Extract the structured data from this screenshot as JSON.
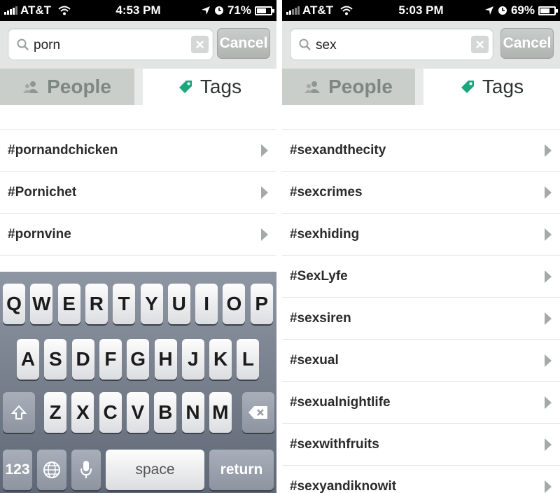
{
  "left": {
    "status": {
      "carrier": "AT&T",
      "time": "4:53 PM",
      "battery": "71%",
      "battery_level": 0.71
    },
    "search": {
      "query": "porn",
      "cancel_label": "Cancel"
    },
    "tabs": {
      "people_label": "People",
      "tags_label": "Tags",
      "active": "Tags"
    },
    "results": [
      "#pornandchicken",
      "#Pornichet",
      "#pornvine"
    ],
    "keyboard": {
      "row1": [
        "Q",
        "W",
        "E",
        "R",
        "T",
        "Y",
        "U",
        "I",
        "O",
        "P"
      ],
      "row2": [
        "A",
        "S",
        "D",
        "F",
        "G",
        "H",
        "J",
        "K",
        "L"
      ],
      "row3": [
        "Z",
        "X",
        "C",
        "V",
        "B",
        "N",
        "M"
      ],
      "numbers_label": "123",
      "space_label": "space",
      "return_label": "return"
    }
  },
  "right": {
    "status": {
      "carrier": "AT&T",
      "time": "5:03 PM",
      "battery": "69%",
      "battery_level": 0.69
    },
    "search": {
      "query": "sex",
      "cancel_label": "Cancel"
    },
    "tabs": {
      "people_label": "People",
      "tags_label": "Tags",
      "active": "Tags"
    },
    "results": [
      "#sexandthecity",
      "#sexcrimes",
      "#sexhiding",
      "#SexLyfe",
      "#sexsiren",
      "#sexual",
      "#sexualnightlife",
      "#sexwithfruits",
      "#sexyandiknowit"
    ]
  },
  "colors": {
    "tag_accent": "#1aa77c",
    "status_bar": "#000000",
    "keyboard_top": "#8f96a3"
  }
}
